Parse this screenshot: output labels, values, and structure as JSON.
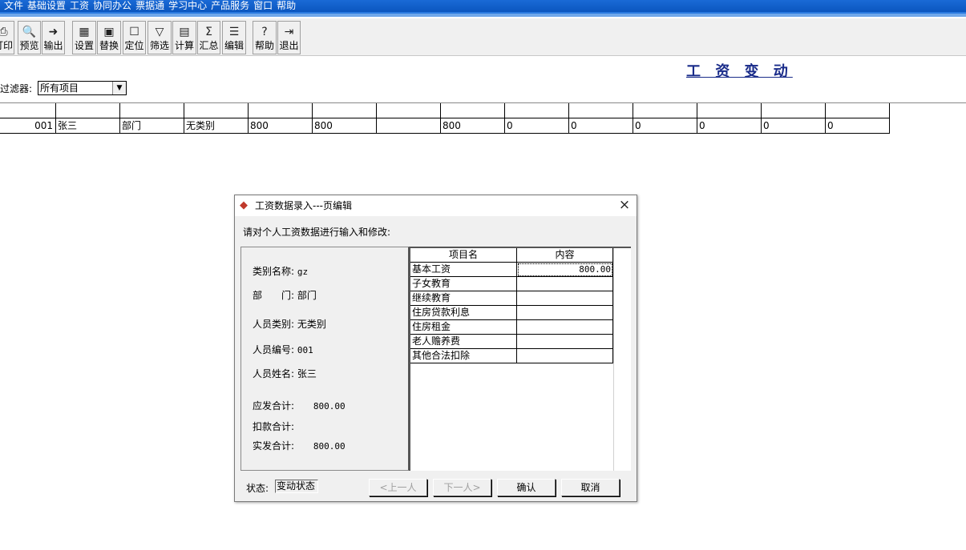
{
  "menubar": {
    "items": [
      "文件",
      "基础设置",
      "工资",
      "协同办公",
      "票据通",
      "学习中心",
      "产品服务",
      "窗口",
      "帮助"
    ]
  },
  "toolbar": {
    "buttons": [
      {
        "label": "打印",
        "icon": "printer-icon",
        "glyph": "⎙"
      },
      {
        "label": "预览",
        "icon": "preview-icon",
        "glyph": "🔍"
      },
      {
        "label": "输出",
        "icon": "export-icon",
        "glyph": "➜"
      },
      {
        "label": "设置",
        "icon": "settings-icon",
        "glyph": "▦"
      },
      {
        "label": "替换",
        "icon": "replace-icon",
        "glyph": "▣"
      },
      {
        "label": "定位",
        "icon": "locate-icon",
        "glyph": "☐"
      },
      {
        "label": "筛选",
        "icon": "filter-icon",
        "glyph": "▽"
      },
      {
        "label": "计算",
        "icon": "calculator-icon",
        "glyph": "▤"
      },
      {
        "label": "汇总",
        "icon": "sum-icon",
        "glyph": "Σ"
      },
      {
        "label": "编辑",
        "icon": "edit-icon",
        "glyph": "☰"
      },
      {
        "label": "帮助",
        "icon": "help-icon",
        "glyph": "?"
      },
      {
        "label": "退出",
        "icon": "exit-icon",
        "glyph": "⇥"
      }
    ]
  },
  "page": {
    "title": "工 资 变 动",
    "filter_label": "过滤器:",
    "filter_value": "所有项目"
  },
  "grid": {
    "header": [
      "",
      "",
      "",
      "",
      "",
      "",
      "",
      "",
      "",
      "",
      "",
      "",
      "",
      ""
    ],
    "rows": [
      [
        "001",
        "张三",
        "部门",
        "无类别",
        "800",
        "800",
        "",
        "800",
        "0",
        "0",
        "0",
        "0",
        "0",
        "0"
      ]
    ]
  },
  "dialog": {
    "title": "工资数据录入---页编辑",
    "close": "×",
    "prompt": "请对个人工资数据进行输入和修改:",
    "info": {
      "category_label": "类别名称:",
      "category_value": "gz",
      "dept_label": "部　　门:",
      "dept_value": "部门",
      "staff_type_label": "人员类别:",
      "staff_type_value": "无类别",
      "staff_id_label": "人员编号:",
      "staff_id_value": "001",
      "staff_name_label": "人员姓名:",
      "staff_name_value": "张三",
      "gross_label": "应发合计:",
      "gross_value": "800.00",
      "deduct_label": "扣款合计:",
      "deduct_value": "",
      "net_label": "实发合计:",
      "net_value": "800.00"
    },
    "items": {
      "header_name": "项目名",
      "header_value": "内容",
      "rows": [
        {
          "name": "基本工资",
          "value": "800.00"
        },
        {
          "name": "子女教育",
          "value": ""
        },
        {
          "name": "继续教育",
          "value": ""
        },
        {
          "name": "住房贷款利息",
          "value": ""
        },
        {
          "name": "住房租金",
          "value": ""
        },
        {
          "name": "老人赡养费",
          "value": ""
        },
        {
          "name": "其他合法扣除",
          "value": ""
        }
      ]
    },
    "status_label": "状态:",
    "status_value": "变动状态",
    "buttons": {
      "prev": "<上一人",
      "next": "下一人>",
      "ok": "确认",
      "cancel": "取消"
    }
  }
}
